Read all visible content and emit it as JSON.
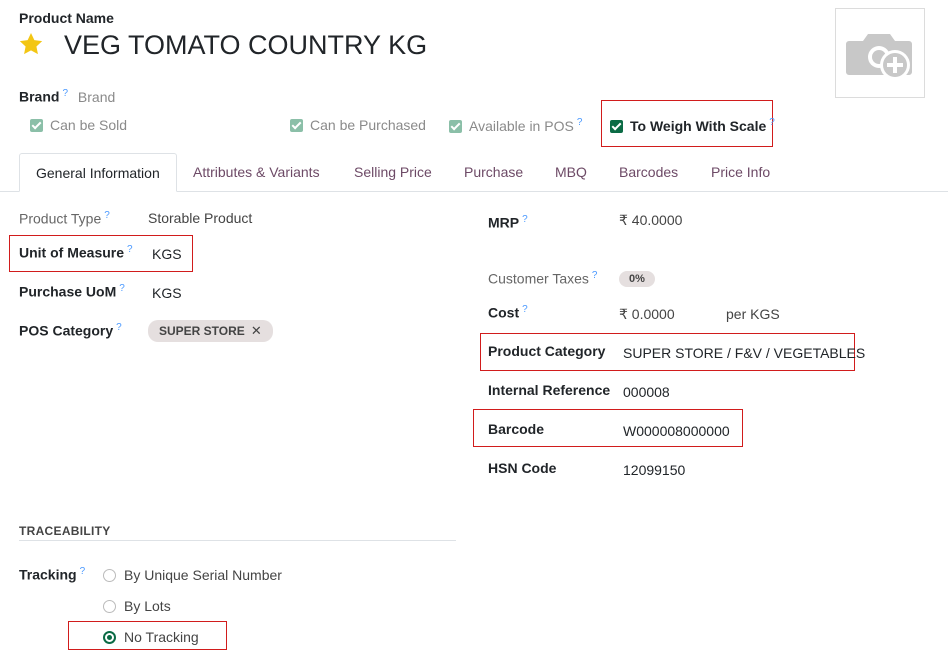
{
  "product": {
    "name_label": "Product Name",
    "name": "VEG TOMATO COUNTRY KG",
    "brand_label": "Brand",
    "brand_placeholder": "Brand"
  },
  "flags": {
    "can_be_sold": "Can be Sold",
    "can_be_purchased": "Can be Purchased",
    "available_in_pos": "Available in POS",
    "to_weigh_with_scale": "To Weigh With Scale"
  },
  "help_mark": "?",
  "tabs": [
    {
      "label": "General Information"
    },
    {
      "label": "Attributes & Variants"
    },
    {
      "label": "Selling Price"
    },
    {
      "label": "Purchase"
    },
    {
      "label": "MBQ"
    },
    {
      "label": "Barcodes"
    },
    {
      "label": "Price Info"
    }
  ],
  "left": {
    "product_type_label": "Product Type",
    "product_type": "Storable Product",
    "uom_label": "Unit of Measure",
    "uom": "KGS",
    "purchase_uom_label": "Purchase UoM",
    "purchase_uom": "KGS",
    "pos_category_label": "POS Category",
    "pos_category": "SUPER STORE"
  },
  "right": {
    "mrp_label": "MRP",
    "mrp": "₹ 40.0000",
    "customer_taxes_label": "Customer Taxes",
    "customer_taxes": "0%",
    "cost_label": "Cost",
    "cost": "₹ 0.0000",
    "cost_unit": "per KGS",
    "product_category_label": "Product Category",
    "product_category": "SUPER STORE / F&V / VEGETABLES",
    "internal_ref_label": "Internal Reference",
    "internal_ref": "000008",
    "barcode_label": "Barcode",
    "barcode": "W000008000000",
    "hsn_label": "HSN Code",
    "hsn": "12099150"
  },
  "traceability": {
    "section_title": "TRACEABILITY",
    "tracking_label": "Tracking",
    "options": [
      {
        "label": "By Unique Serial Number",
        "selected": false
      },
      {
        "label": "By Lots",
        "selected": false
      },
      {
        "label": "No Tracking",
        "selected": true
      }
    ]
  },
  "colors": {
    "accent": "#0b6b45",
    "highlight_box": "#d11c1c",
    "tab_text": "#6d4a66",
    "star": "#f3c614"
  }
}
